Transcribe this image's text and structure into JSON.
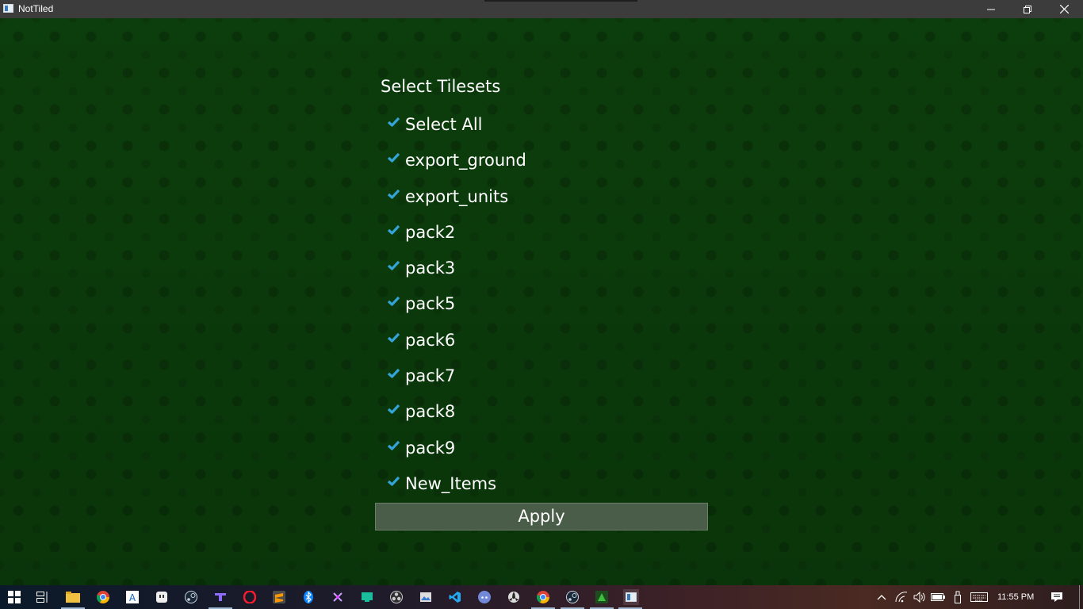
{
  "window": {
    "title": "NotTiled"
  },
  "dialog": {
    "heading": "Select Tilesets",
    "items": [
      {
        "label": "Select All",
        "checked": true
      },
      {
        "label": "export_ground",
        "checked": true
      },
      {
        "label": "export_units",
        "checked": true
      },
      {
        "label": "pack2",
        "checked": true
      },
      {
        "label": "pack3",
        "checked": true
      },
      {
        "label": "pack5",
        "checked": true
      },
      {
        "label": "pack6",
        "checked": true
      },
      {
        "label": "pack7",
        "checked": true
      },
      {
        "label": "pack8",
        "checked": true
      },
      {
        "label": "pack9",
        "checked": true
      },
      {
        "label": "New_Items",
        "checked": true
      }
    ],
    "apply_label": "Apply"
  },
  "taskbar": {
    "clock": "11:55 PM",
    "icons": [
      "start-icon",
      "task-view-icon",
      "file-explorer-icon",
      "chrome-icon",
      "aseprite-icon",
      "app-icon",
      "steam-icon",
      "app-icon",
      "opera-icon",
      "sublime-text-icon",
      "bluetooth-icon",
      "app-icon",
      "app-icon",
      "obs-icon",
      "app-icon",
      "vscode-icon",
      "discord-icon",
      "app-icon",
      "chrome-icon",
      "steam-icon",
      "app-icon",
      "nottiled-icon"
    ]
  },
  "colors": {
    "accent_check": "#34a4d8",
    "background": "#0c3d0c",
    "apply_bg": "#4a5d48"
  }
}
